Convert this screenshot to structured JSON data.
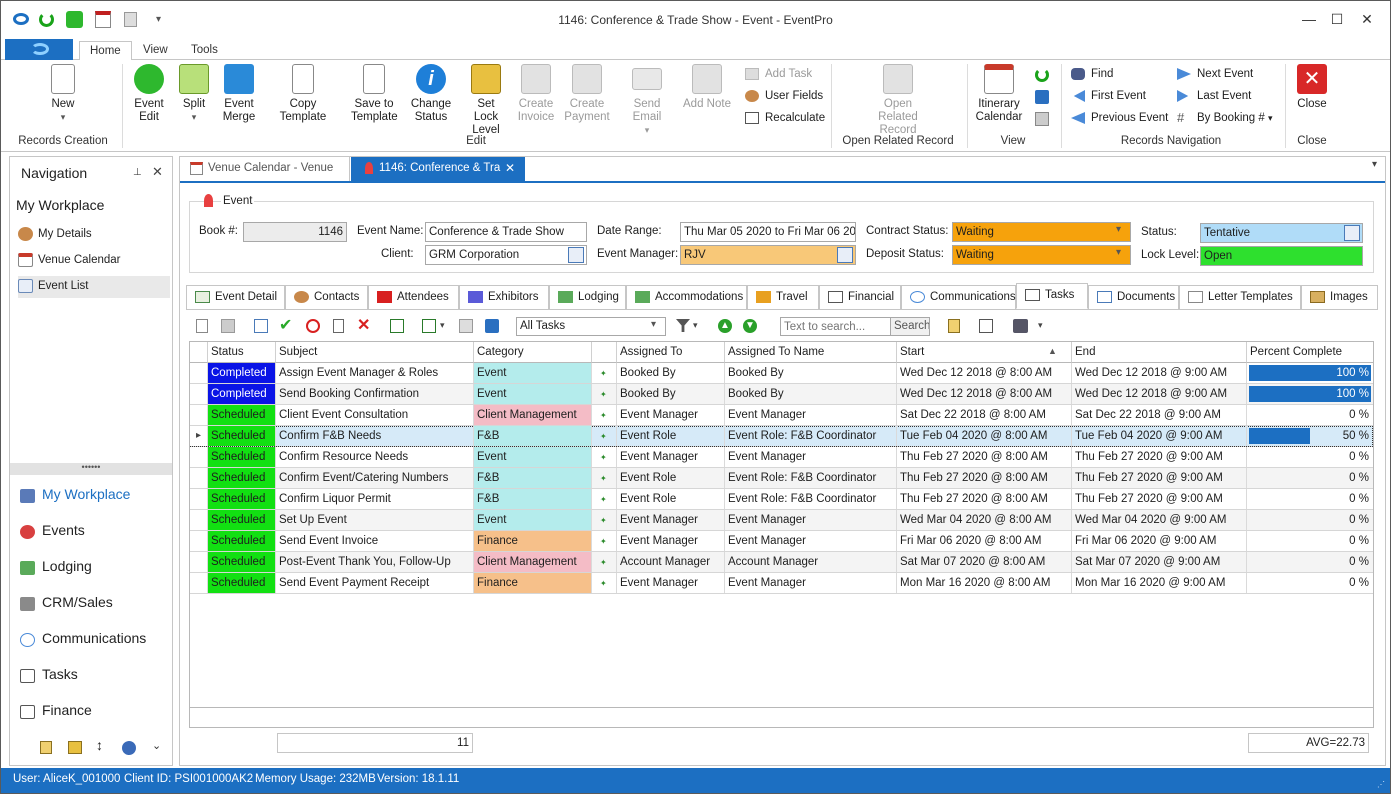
{
  "window": {
    "title": "1146: Conference & Trade Show - Event - EventPro"
  },
  "ribbon_tabs": [
    "Home",
    "View",
    "Tools"
  ],
  "ribbon": {
    "new": "New",
    "event_edit": "Event Edit",
    "split": "Split",
    "event_merge": "Event Merge",
    "copy_template": "Copy Template",
    "save_to_template": "Save to Template",
    "change_status": "Change Status",
    "set_lock_level": "Set Lock Level",
    "create_invoice": "Create Invoice",
    "create_payment": "Create Payment",
    "send_email": "Send Email",
    "add_note": "Add Note",
    "add_task": "Add Task",
    "user_fields": "User Fields",
    "recalculate": "Recalculate",
    "open_related_record": "Open Related Record",
    "itinerary_calendar": "Itinerary Calendar",
    "find": "Find",
    "first_event": "First Event",
    "previous_event": "Previous Event",
    "next_event": "Next Event",
    "last_event": "Last Event",
    "by_booking": "By Booking #",
    "close": "Close",
    "groups": {
      "records_creation": "Records Creation",
      "edit": "Edit",
      "open_related_record": "Open Related Record",
      "view": "View",
      "records_navigation": "Records Navigation",
      "close": "Close"
    }
  },
  "nav": {
    "title": "Navigation",
    "workplace": "My Workplace",
    "items": [
      "My Details",
      "Venue Calendar",
      "Event List"
    ],
    "big": [
      "My Workplace",
      "Events",
      "Lodging",
      "CRM/Sales",
      "Communications",
      "Tasks",
      "Finance"
    ]
  },
  "doc_tabs": [
    "Venue Calendar - Venue",
    "1146: Conference & Tra"
  ],
  "event": {
    "section": "Event",
    "book_label": "Book #:",
    "book": "1146",
    "name_label": "Event Name:",
    "name": "Conference & Trade Show",
    "client_label": "Client:",
    "client": "GRM Corporation",
    "date_label": "Date Range:",
    "date": "Thu Mar 05 2020 to Fri Mar 06 2020",
    "manager_label": "Event Manager:",
    "manager": "RJV",
    "contract_label": "Contract Status:",
    "contract": "Waiting",
    "deposit_label": "Deposit Status:",
    "deposit": "Waiting",
    "status_label": "Status:",
    "status": "Tentative",
    "lock_label": "Lock Level:",
    "lock": "Open"
  },
  "sub_tabs": [
    "Event Detail",
    "Contacts",
    "Attendees",
    "Exhibitors",
    "Lodging",
    "Accommodations",
    "Travel",
    "Financial",
    "Communications",
    "Tasks",
    "Documents",
    "Letter Templates",
    "Images"
  ],
  "toolbar": {
    "filter": "All Tasks",
    "search_placeholder": "Text to search...",
    "search_button": "Search"
  },
  "grid": {
    "columns": [
      "Status",
      "Subject",
      "Category",
      "",
      "Assigned To",
      "Assigned To Name",
      "Start",
      "End",
      "Percent Complete"
    ],
    "rows": [
      {
        "status": "Completed",
        "subject": "Assign Event Manager & Roles",
        "category": "Event",
        "assigned": "Booked By",
        "name": "Booked By",
        "start": "Wed Dec 12 2018 @ 8:00 AM",
        "end": "Wed Dec 12 2018 @ 9:00 AM",
        "pct": "100 %",
        "frac": 1.0
      },
      {
        "status": "Completed",
        "subject": "Send Booking Confirmation",
        "category": "Event",
        "assigned": "Booked By",
        "name": "Booked By",
        "start": "Wed Dec 12 2018 @ 8:00 AM",
        "end": "Wed Dec 12 2018 @ 9:00 AM",
        "pct": "100 %",
        "frac": 1.0
      },
      {
        "status": "Scheduled",
        "subject": "Client Event Consultation",
        "category": "Client Management",
        "assigned": "Event Manager",
        "name": "Event Manager",
        "start": "Sat Dec 22 2018 @ 8:00 AM",
        "end": "Sat Dec 22 2018 @ 9:00 AM",
        "pct": "0 %",
        "frac": 0
      },
      {
        "status": "Scheduled",
        "subject": "Confirm F&B Needs",
        "category": "F&B",
        "assigned": "Event Role",
        "name": "Event Role: F&B Coordinator",
        "start": "Tue Feb 04 2020 @ 8:00 AM",
        "end": "Tue Feb 04 2020 @ 9:00 AM",
        "pct": "50 %",
        "frac": 0.5
      },
      {
        "status": "Scheduled",
        "subject": "Confirm Resource Needs",
        "category": "Event",
        "assigned": "Event Manager",
        "name": "Event Manager",
        "start": "Thu Feb 27 2020 @ 8:00 AM",
        "end": "Thu Feb 27 2020 @ 9:00 AM",
        "pct": "0 %",
        "frac": 0
      },
      {
        "status": "Scheduled",
        "subject": "Confirm Event/Catering Numbers",
        "category": "F&B",
        "assigned": "Event Role",
        "name": "Event Role: F&B Coordinator",
        "start": "Thu Feb 27 2020 @ 8:00 AM",
        "end": "Thu Feb 27 2020 @ 9:00 AM",
        "pct": "0 %",
        "frac": 0
      },
      {
        "status": "Scheduled",
        "subject": "Confirm Liquor Permit",
        "category": "F&B",
        "assigned": "Event Role",
        "name": "Event Role: F&B Coordinator",
        "start": "Thu Feb 27 2020 @ 8:00 AM",
        "end": "Thu Feb 27 2020 @ 9:00 AM",
        "pct": "0 %",
        "frac": 0
      },
      {
        "status": "Scheduled",
        "subject": "Set Up Event",
        "category": "Event",
        "assigned": "Event Manager",
        "name": "Event Manager",
        "start": "Wed Mar 04 2020 @ 8:00 AM",
        "end": "Wed Mar 04 2020 @ 9:00 AM",
        "pct": "0 %",
        "frac": 0
      },
      {
        "status": "Scheduled",
        "subject": "Send Event Invoice",
        "category": "Finance",
        "assigned": "Event Manager",
        "name": "Event Manager",
        "start": "Fri Mar 06 2020 @ 8:00 AM",
        "end": "Fri Mar 06 2020 @ 9:00 AM",
        "pct": "0 %",
        "frac": 0
      },
      {
        "status": "Scheduled",
        "subject": "Post-Event Thank You, Follow-Up",
        "category": "Client Management",
        "assigned": "Account Manager",
        "name": "Account Manager",
        "start": "Sat Mar 07 2020 @ 8:00 AM",
        "end": "Sat Mar 07 2020 @ 9:00 AM",
        "pct": "0 %",
        "frac": 0
      },
      {
        "status": "Scheduled",
        "subject": "Send Event Payment Receipt",
        "category": "Finance",
        "assigned": "Event Manager",
        "name": "Event Manager",
        "start": "Mon Mar 16 2020 @ 8:00 AM",
        "end": "Mon Mar 16 2020 @ 9:00 AM",
        "pct": "0 %",
        "frac": 0
      }
    ],
    "count": "11",
    "avg": "AVG=22.73"
  },
  "statusbar": {
    "user": "User: AliceK_001000",
    "client": "Client ID: PSI001000AK2",
    "memory": "Memory Usage: 232MB",
    "version": "Version: 18.1.11"
  },
  "colors": {
    "completed": "#0a14e6",
    "scheduled": "#12e012",
    "event": "#b4ecec",
    "client_mgmt": "#f4bcc6",
    "finance": "#f6c08a",
    "fnb": "#b4ecec",
    "waiting": "#f6a20c",
    "tentative": "#b0dcf8",
    "open": "#2ee02e",
    "manager": "#f8c878",
    "accent": "#1c6fc2"
  }
}
